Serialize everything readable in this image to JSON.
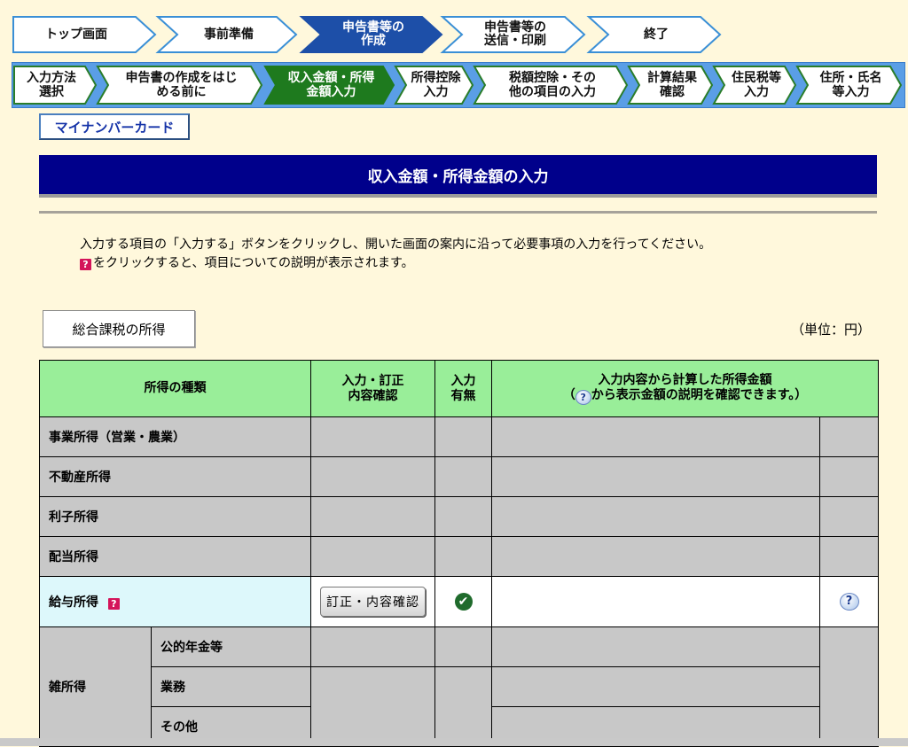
{
  "steps_main": [
    {
      "label": "トップ画面",
      "state": "normal"
    },
    {
      "label": "事前準備",
      "state": "normal"
    },
    {
      "label": "申告書等の\n作成",
      "state": "active"
    },
    {
      "label": "申告書等の\n送信・印刷",
      "state": "normal"
    },
    {
      "label": "終了",
      "state": "normal"
    }
  ],
  "steps_sub": [
    {
      "label": "入力方法\n選択",
      "state": "normal"
    },
    {
      "label": "申告書の作成をはじ\nめる前に",
      "state": "normal"
    },
    {
      "label": "収入金額・所得\n金額入力",
      "state": "active"
    },
    {
      "label": "所得控除\n入力",
      "state": "normal"
    },
    {
      "label": "税額控除・その\n他の項目の入力",
      "state": "normal"
    },
    {
      "label": "計算結果\n確認",
      "state": "normal"
    },
    {
      "label": "住民税等\n入力",
      "state": "normal"
    },
    {
      "label": "住所・氏名\n等入力",
      "state": "normal"
    }
  ],
  "mynumber_label": "マイナンバーカード",
  "page_title": "収入金額・所得金額の入力",
  "description": {
    "line1": "入力する項目の「入力する」ボタンをクリックし、開いた画面の案内に沿って必要事項の入力を行ってください。",
    "line2_icon": "?",
    "line2": "をクリックすると、項目についての説明が表示されます。"
  },
  "section_tab": "総合課税の所得",
  "unit_label": "（単位：円）",
  "table": {
    "headers": {
      "kind": "所得の種類",
      "input": "入力・訂正\n内容確認",
      "has": "入力\n有無",
      "amount_line1": "入力内容から計算した所得金額",
      "amount_line2_pre": "（",
      "amount_line2_icon": "?",
      "amount_line2_post": "から表示金額の説明を確認できます。）"
    },
    "rows": [
      {
        "label": "事業所得（営業・農業）"
      },
      {
        "label": "不動産所得"
      },
      {
        "label": "利子所得"
      },
      {
        "label": "配当所得"
      }
    ],
    "salary": {
      "label": "給与所得",
      "help_icon": "?",
      "button": "訂正・内容確認",
      "check_icon": "✔",
      "amount": "",
      "detail_icon": "?"
    },
    "misc": {
      "label": "雑所得",
      "subs": [
        "公的年金等",
        "業務",
        "その他"
      ]
    }
  },
  "colors": {
    "background": "#fff8dc",
    "banner": "#00008b",
    "header_green": "#99ee99",
    "active_main": "#1d4fa8",
    "active_sub": "#1e7a1e"
  }
}
